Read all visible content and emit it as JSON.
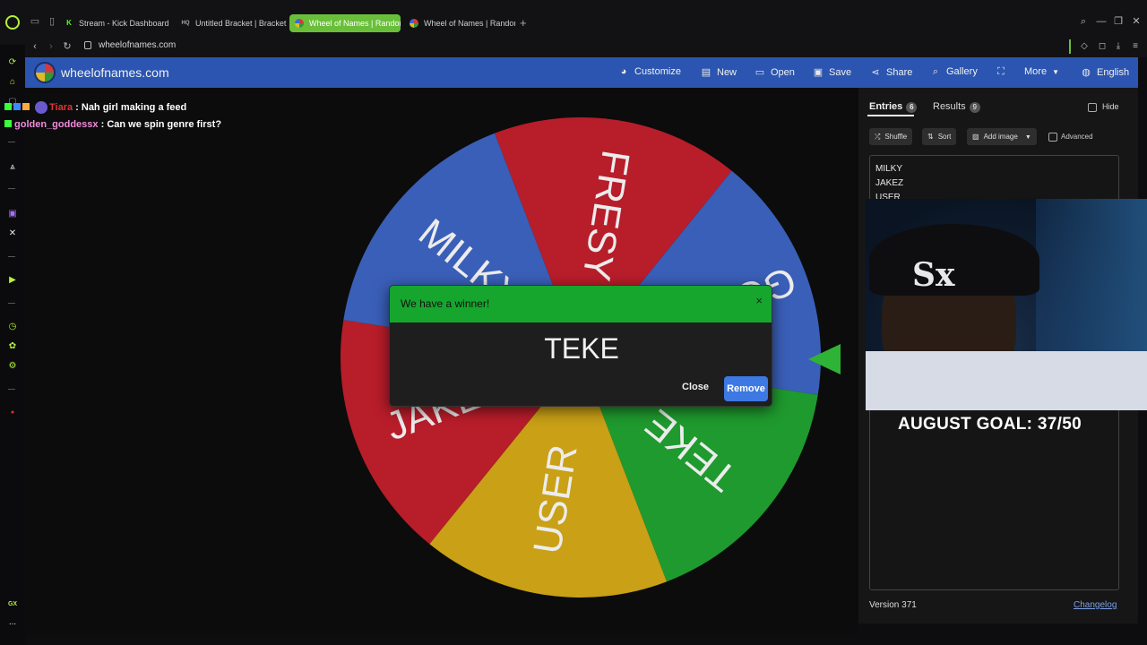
{
  "browser": {
    "tabs": [
      {
        "label": "Stream - Kick Dashboard",
        "favicon": "K"
      },
      {
        "label": "Untitled Bracket | Bracket",
        "favicon": "HQ"
      },
      {
        "label": "Wheel of Names | Random",
        "favicon": "W"
      },
      {
        "label": "Wheel of Names | Random",
        "favicon": "W"
      }
    ],
    "url": "wheelofnames.com"
  },
  "sidebar": {
    "bottom_label": "GX",
    "more": "..."
  },
  "header": {
    "title": "wheelofnames.com",
    "customize": "Customize",
    "new": "New",
    "open": "Open",
    "save": "Save",
    "share": "Share",
    "gallery": "Gallery",
    "more": "More",
    "language": "English"
  },
  "chat": [
    {
      "user": "Tiara",
      "message": ": Nah girl making a feed"
    },
    {
      "user": "golden_goddessx",
      "message": ": Can we spin genre first?"
    }
  ],
  "wheel": {
    "segments": [
      {
        "label": "FRESY",
        "color": "#b81d2a"
      },
      {
        "label": "GOLDEN",
        "color": "#3a5fb8"
      },
      {
        "label": "TEKE",
        "color": "#1f9a2e"
      },
      {
        "label": "USER",
        "color": "#c9a016"
      },
      {
        "label": "JAKEZ",
        "color": "#b81d2a"
      },
      {
        "label": "MILKY",
        "color": "#3a5fb8"
      }
    ]
  },
  "dialog": {
    "title": "We have a winner!",
    "winner": "TEKE",
    "close": "Close",
    "remove": "Remove",
    "x": "×"
  },
  "panel": {
    "entries_tab": "Entries",
    "entries_count": "6",
    "results_tab": "Results",
    "results_count": "9",
    "hide": "Hide",
    "shuffle": "Shuffle",
    "sort": "Sort",
    "add_image": "Add image",
    "advanced": "Advanced",
    "entries": [
      "MILKY",
      "JAKEZ",
      "USER"
    ],
    "version": "Version 371",
    "changelog": "Changelog"
  },
  "overlay": {
    "goal": "AUGUST GOAL: 37/50",
    "cap_logo": "Sx"
  }
}
